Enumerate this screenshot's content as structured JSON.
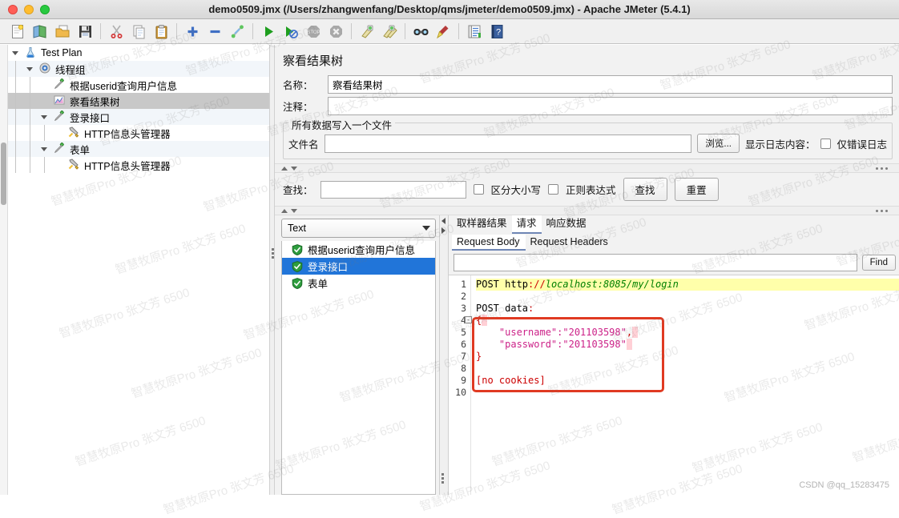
{
  "window": {
    "title": "demo0509.jmx (/Users/zhangwenfang/Desktop/qms/jmeter/demo0509.jmx) - Apache JMeter (5.4.1)",
    "controls": [
      "close",
      "minimize",
      "maximize"
    ]
  },
  "toolbar": {
    "items": [
      {
        "name": "new-icon",
        "glyph": "🗋",
        "tip": "New"
      },
      {
        "name": "templates-icon",
        "glyph": "🗺",
        "tip": "Templates"
      },
      {
        "name": "open-icon",
        "glyph": "📂",
        "tip": "Open"
      },
      {
        "name": "save-icon",
        "glyph": "💾",
        "tip": "Save"
      },
      {
        "name": "cut-icon",
        "glyph": "✂",
        "tip": "Cut"
      },
      {
        "name": "copy-icon",
        "glyph": "🗐",
        "tip": "Copy"
      },
      {
        "name": "paste-icon",
        "glyph": "📋",
        "tip": "Paste"
      },
      {
        "name": "expand-icon",
        "glyph": "＋",
        "tip": "Expand All"
      },
      {
        "name": "collapse-icon",
        "glyph": "－",
        "tip": "Collapse All"
      },
      {
        "name": "toggle-icon",
        "glyph": "🧪",
        "tip": "Toggle"
      },
      {
        "name": "start-icon",
        "glyph": "▶",
        "tip": "Start"
      },
      {
        "name": "start-no-pauses-icon",
        "glyph": "▶",
        "tip": "Start no pauses"
      },
      {
        "name": "stop-icon",
        "glyph": "⬣",
        "tip": "Stop"
      },
      {
        "name": "shutdown-icon",
        "glyph": "✖",
        "tip": "Shutdown"
      },
      {
        "name": "clear-icon",
        "glyph": "🧹",
        "tip": "Clear"
      },
      {
        "name": "clear-all-icon",
        "glyph": "🧹",
        "tip": "Clear All"
      },
      {
        "name": "search-icon",
        "glyph": "🔭",
        "tip": "Search"
      },
      {
        "name": "reset-search-icon",
        "glyph": "🧹",
        "tip": "Reset Search"
      },
      {
        "name": "function-helper-icon",
        "glyph": "▤",
        "tip": "Function Helper"
      },
      {
        "name": "help-icon",
        "glyph": "？",
        "tip": "Help"
      }
    ]
  },
  "tree": {
    "nodes": [
      {
        "label": "Test Plan",
        "icon": "test-plan-icon",
        "depth": 0,
        "expanded": true,
        "selected": false,
        "alt": false
      },
      {
        "label": "线程组",
        "icon": "thread-group-icon",
        "depth": 1,
        "expanded": true,
        "selected": false,
        "alt": true
      },
      {
        "label": "根据userid查询用户信息",
        "icon": "sampler-icon",
        "depth": 2,
        "expanded": null,
        "selected": false,
        "alt": false
      },
      {
        "label": "察看结果树",
        "icon": "results-tree-icon",
        "depth": 2,
        "expanded": null,
        "selected": true,
        "alt": false
      },
      {
        "label": "登录接口",
        "icon": "sampler-icon",
        "depth": 2,
        "expanded": true,
        "selected": false,
        "alt": true
      },
      {
        "label": "HTTP信息头管理器",
        "icon": "header-manager-icon",
        "depth": 3,
        "expanded": null,
        "selected": false,
        "alt": false
      },
      {
        "label": "表单",
        "icon": "sampler-icon",
        "depth": 2,
        "expanded": true,
        "selected": false,
        "alt": true
      },
      {
        "label": "HTTP信息头管理器",
        "icon": "header-manager-icon",
        "depth": 3,
        "expanded": null,
        "selected": false,
        "alt": false
      }
    ]
  },
  "panel": {
    "title": "察看结果树",
    "name_label": "名称：",
    "name_value": "察看结果树",
    "comment_label": "注释：",
    "comment_value": "",
    "file_group_title": "所有数据写入一个文件",
    "filename_label": "文件名",
    "filename_value": "",
    "browse_button": "浏览...",
    "log_display_label": "显示日志内容：",
    "errors_only_label": "仅错误日志",
    "errors_only_checked": false
  },
  "search": {
    "label": "查找：",
    "value": "",
    "case_sensitive_label": "区分大小写",
    "case_sensitive_checked": false,
    "regex_label": "正则表达式",
    "regex_checked": false,
    "find_button": "查找",
    "reset_button": "重置"
  },
  "results": {
    "renderer_selected": "Text",
    "items": [
      {
        "label": "根据userid查询用户信息",
        "status": "success",
        "selected": false
      },
      {
        "label": "登录接口",
        "status": "success",
        "selected": true
      },
      {
        "label": "表单",
        "status": "success",
        "selected": false
      }
    ]
  },
  "detail": {
    "tabs": [
      {
        "label": "取样器结果",
        "active": false
      },
      {
        "label": "请求",
        "active": true
      },
      {
        "label": "响应数据",
        "active": false
      }
    ],
    "subtabs": [
      {
        "label": "Request Body",
        "active": true
      },
      {
        "label": "Request Headers",
        "active": false
      }
    ],
    "find_value": "",
    "find_button": "Find",
    "line_numbers": [
      "1",
      "2",
      "3",
      "4",
      "5",
      "6",
      "7",
      "8",
      "9",
      "10"
    ],
    "code_lines": [
      {
        "n": 1,
        "highlight": true,
        "fold": false,
        "tokens": [
          {
            "t": "POST ",
            "c": "plain"
          },
          {
            "t": "http",
            "c": "plain"
          },
          {
            "t": "://",
            "c": "op"
          },
          {
            "t": "localhost:8085/my/login",
            "c": "url"
          }
        ]
      },
      {
        "n": 2,
        "highlight": false,
        "fold": false,
        "tokens": []
      },
      {
        "n": 3,
        "highlight": false,
        "fold": false,
        "tokens": [
          {
            "t": "POST data",
            "c": "plain"
          },
          {
            "t": ":",
            "c": "op"
          }
        ]
      },
      {
        "n": 4,
        "highlight": false,
        "fold": true,
        "tokens": [
          {
            "t": "{",
            "c": "brace"
          },
          {
            "t": " ",
            "c": "sel"
          }
        ]
      },
      {
        "n": 5,
        "highlight": false,
        "fold": false,
        "tokens": [
          {
            "t": "    ",
            "c": "plain"
          },
          {
            "t": "\"username\":\"201103598\"",
            "c": "str"
          },
          {
            "t": ",",
            "c": "op"
          },
          {
            "t": " ",
            "c": "sel"
          }
        ]
      },
      {
        "n": 6,
        "highlight": false,
        "fold": false,
        "tokens": [
          {
            "t": "    ",
            "c": "plain"
          },
          {
            "t": "\"password\":\"201103598\"",
            "c": "str"
          },
          {
            "t": " ",
            "c": "sel"
          }
        ]
      },
      {
        "n": 7,
        "highlight": false,
        "fold": false,
        "tokens": [
          {
            "t": "}",
            "c": "brace"
          }
        ]
      },
      {
        "n": 8,
        "highlight": false,
        "fold": false,
        "tokens": []
      },
      {
        "n": 9,
        "highlight": false,
        "fold": false,
        "tokens": [
          {
            "t": "[no cookies]",
            "c": "cookie"
          }
        ]
      },
      {
        "n": 10,
        "highlight": false,
        "fold": false,
        "tokens": []
      }
    ]
  },
  "watermarks": {
    "text": "智慧牧原Pro 张文芳 6500",
    "credit": "CSDN @qq_15283475"
  },
  "colors": {
    "accent_selection": "#2175d9",
    "tree_selection": "#c8c8c8",
    "code_highlight": "#ffffaa",
    "annotation_box": "#e03a22",
    "string_token": "#cc2288",
    "url_token": "#008000"
  }
}
